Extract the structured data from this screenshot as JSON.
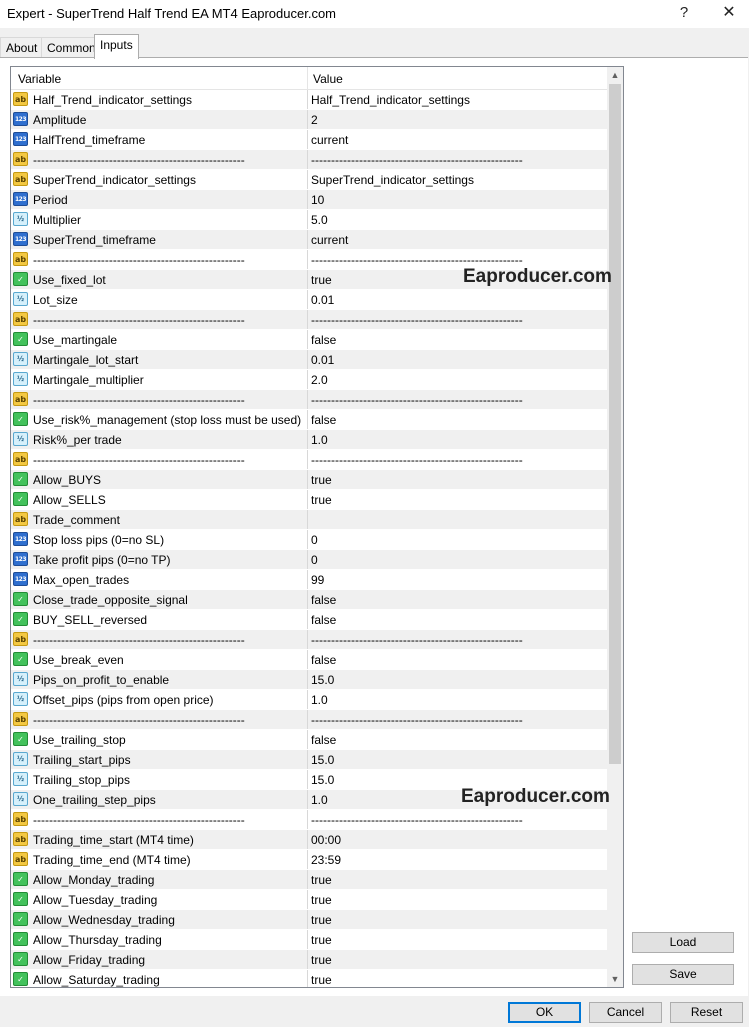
{
  "window": {
    "title": "Expert - SuperTrend Half Trend EA MT4 Eaproducer.com",
    "help": "?",
    "close": "✕"
  },
  "tabs": [
    {
      "label": "About"
    },
    {
      "label": "Common"
    },
    {
      "label": "Inputs"
    }
  ],
  "grid": {
    "header": {
      "variable": "Variable",
      "value": "Value"
    },
    "rows": [
      {
        "type": "ab",
        "name": "Half_Trend_indicator_settings",
        "value": "Half_Trend_indicator_settings"
      },
      {
        "type": "123",
        "name": "Amplitude",
        "value": "2"
      },
      {
        "type": "123",
        "name": "HalfTrend_timeframe",
        "value": "current"
      },
      {
        "type": "ab",
        "name": "-----------------------------------------------------",
        "value": "-----------------------------------------------------"
      },
      {
        "type": "ab",
        "name": "SuperTrend_indicator_settings",
        "value": "SuperTrend_indicator_settings"
      },
      {
        "type": "123",
        "name": "Period",
        "value": "10"
      },
      {
        "type": "half",
        "name": "Multiplier",
        "value": "5.0"
      },
      {
        "type": "123",
        "name": "SuperTrend_timeframe",
        "value": "current"
      },
      {
        "type": "ab",
        "name": "-----------------------------------------------------",
        "value": "-----------------------------------------------------"
      },
      {
        "type": "bool",
        "name": "Use_fixed_lot",
        "value": "true"
      },
      {
        "type": "half",
        "name": "Lot_size",
        "value": "0.01"
      },
      {
        "type": "ab",
        "name": "-----------------------------------------------------",
        "value": "-----------------------------------------------------"
      },
      {
        "type": "bool",
        "name": "Use_martingale",
        "value": "false"
      },
      {
        "type": "half",
        "name": "Martingale_lot_start",
        "value": "0.01"
      },
      {
        "type": "half",
        "name": "Martingale_multiplier",
        "value": "2.0"
      },
      {
        "type": "ab",
        "name": "-----------------------------------------------------",
        "value": "-----------------------------------------------------"
      },
      {
        "type": "bool",
        "name": "Use_risk%_management (stop loss must be used)",
        "value": "false"
      },
      {
        "type": "half",
        "name": "Risk%_per trade",
        "value": "1.0"
      },
      {
        "type": "ab",
        "name": "-----------------------------------------------------",
        "value": "-----------------------------------------------------"
      },
      {
        "type": "bool",
        "name": "Allow_BUYS",
        "value": "true"
      },
      {
        "type": "bool",
        "name": "Allow_SELLS",
        "value": "true"
      },
      {
        "type": "ab",
        "name": "Trade_comment",
        "value": ""
      },
      {
        "type": "123",
        "name": "Stop loss pips (0=no SL)",
        "value": "0"
      },
      {
        "type": "123",
        "name": "Take profit pips (0=no TP)",
        "value": "0"
      },
      {
        "type": "123",
        "name": "Max_open_trades",
        "value": "99"
      },
      {
        "type": "bool",
        "name": "Close_trade_opposite_signal",
        "value": "false"
      },
      {
        "type": "bool",
        "name": "BUY_SELL_reversed",
        "value": "false"
      },
      {
        "type": "ab",
        "name": "-----------------------------------------------------",
        "value": "-----------------------------------------------------"
      },
      {
        "type": "bool",
        "name": "Use_break_even",
        "value": "false"
      },
      {
        "type": "half",
        "name": "Pips_on_profit_to_enable",
        "value": "15.0"
      },
      {
        "type": "half",
        "name": "Offset_pips (pips from open price)",
        "value": "1.0"
      },
      {
        "type": "ab",
        "name": "-----------------------------------------------------",
        "value": "-----------------------------------------------------"
      },
      {
        "type": "bool",
        "name": "Use_trailing_stop",
        "value": "false"
      },
      {
        "type": "half",
        "name": "Trailing_start_pips",
        "value": "15.0"
      },
      {
        "type": "half",
        "name": "Trailing_stop_pips",
        "value": "15.0"
      },
      {
        "type": "half",
        "name": "One_trailing_step_pips",
        "value": "1.0"
      },
      {
        "type": "ab",
        "name": "-----------------------------------------------------",
        "value": "-----------------------------------------------------"
      },
      {
        "type": "ab",
        "name": "Trading_time_start (MT4 time)",
        "value": "00:00"
      },
      {
        "type": "ab",
        "name": "Trading_time_end  (MT4 time)",
        "value": "23:59"
      },
      {
        "type": "bool",
        "name": "Allow_Monday_trading",
        "value": "true"
      },
      {
        "type": "bool",
        "name": "Allow_Tuesday_trading",
        "value": "true"
      },
      {
        "type": "bool",
        "name": "Allow_Wednesday_trading",
        "value": "true"
      },
      {
        "type": "bool",
        "name": "Allow_Thursday_trading",
        "value": "true"
      },
      {
        "type": "bool",
        "name": "Allow_Friday_trading",
        "value": "true"
      },
      {
        "type": "bool",
        "name": "Allow_Saturday_trading",
        "value": "true"
      }
    ]
  },
  "icon_glyphs": {
    "ab": "ab",
    "123": "123",
    "half": "½",
    "bool": "✓"
  },
  "scrollbar": {
    "up": "▲",
    "down": "▼"
  },
  "watermarks": [
    "Eaproducer.com",
    "Eaproducer.com"
  ],
  "buttons": {
    "load": "Load",
    "save": "Save",
    "ok": "OK",
    "cancel": "Cancel",
    "reset": "Reset"
  }
}
